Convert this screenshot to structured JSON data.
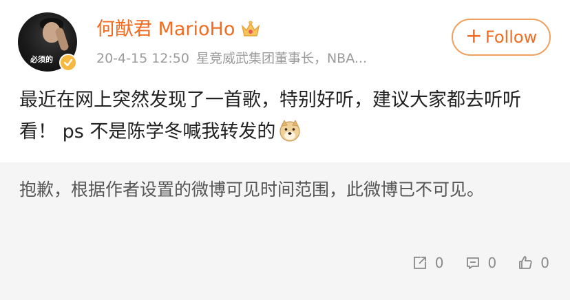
{
  "author": {
    "name": "何猷君 MarioHo",
    "avatar_caption": "必须的",
    "timestamp": "20-4-15 12:50",
    "description": "星竞威武集团董事长，NBA..."
  },
  "follow_label": "Follow",
  "post": {
    "text": "最近在网上突然发现了一首歌，特别好听，建议大家都去听听看！ ps 不是陈学冬喊我转发的"
  },
  "repost": {
    "notice": "抱歉，根据作者设置的微博可见时间范围，此微博已不可见。"
  },
  "actions": {
    "share_count": "0",
    "comment_count": "0",
    "like_count": "0"
  },
  "colors": {
    "accent": "#f26b20",
    "follow_border": "#f0a05e",
    "meta_text": "#9b9b9b",
    "repost_bg": "#f5f5f5",
    "verified_badge": "#f5b942"
  },
  "icons": [
    "crown-icon",
    "verified-badge-icon",
    "plus-icon",
    "doge-emoji-icon",
    "share-icon",
    "comment-icon",
    "like-icon"
  ]
}
